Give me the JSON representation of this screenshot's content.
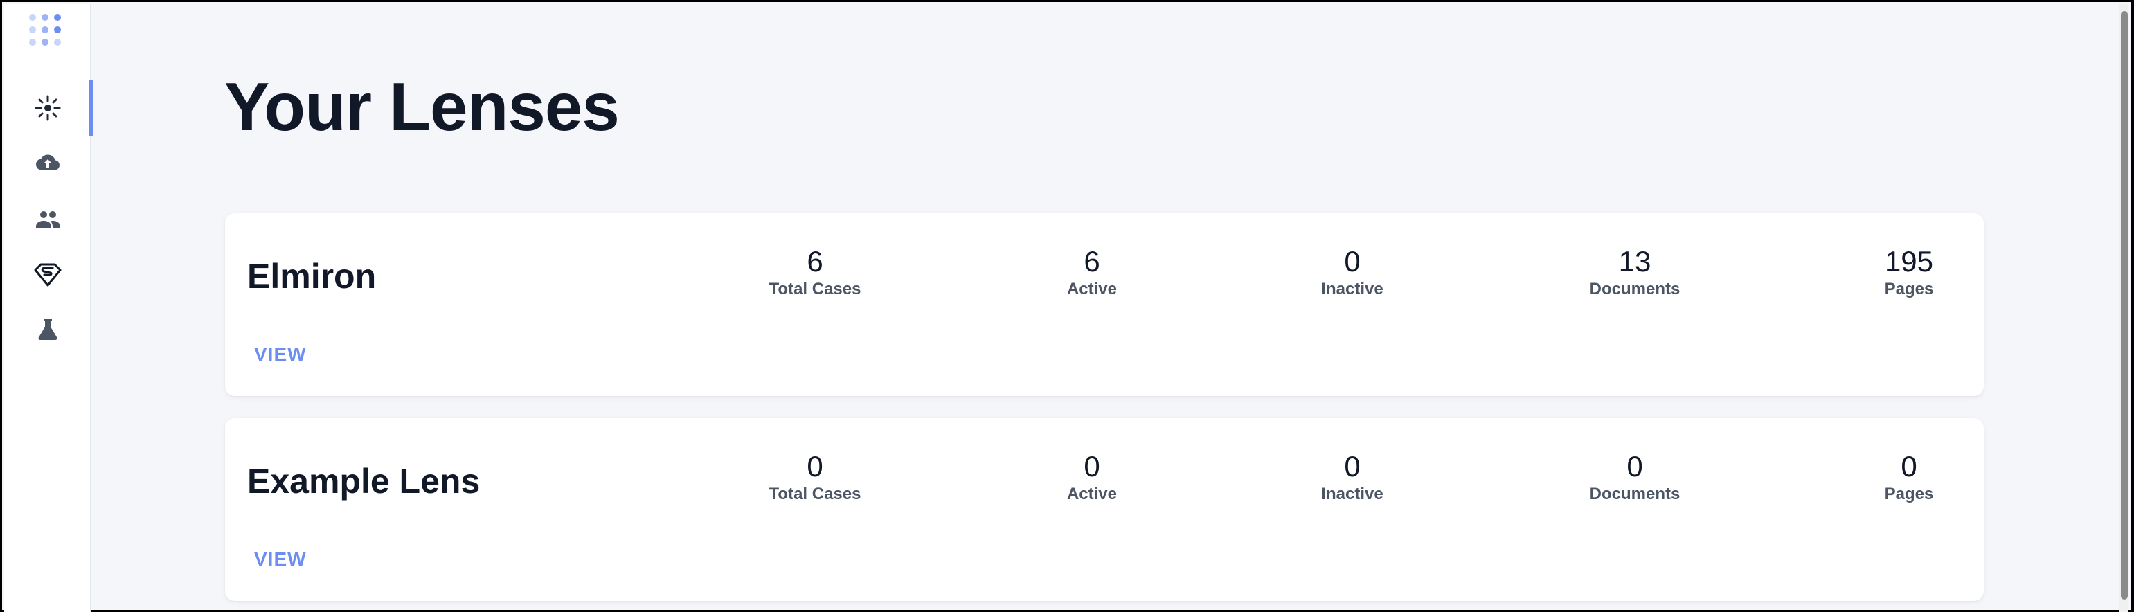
{
  "page": {
    "title": "Your Lenses"
  },
  "colors": {
    "accent": "#6b8ef0",
    "text": "#111827",
    "muted": "#4b5563",
    "background": "#f5f6fa"
  },
  "sidebar": {
    "logo": "dots-grid-logo",
    "items": [
      {
        "icon": "lens-sparkle-icon",
        "active": true
      },
      {
        "icon": "cloud-upload-icon",
        "active": false
      },
      {
        "icon": "people-icon",
        "active": false
      },
      {
        "icon": "superman-shield-icon",
        "active": false
      },
      {
        "icon": "flask-icon",
        "active": false
      }
    ]
  },
  "lenses": [
    {
      "name": "Elmiron",
      "view_label": "VIEW",
      "stats": [
        {
          "value": "6",
          "label": "Total Cases"
        },
        {
          "value": "6",
          "label": "Active"
        },
        {
          "value": "0",
          "label": "Inactive"
        },
        {
          "value": "13",
          "label": "Documents"
        },
        {
          "value": "195",
          "label": "Pages"
        }
      ]
    },
    {
      "name": "Example Lens",
      "view_label": "VIEW",
      "stats": [
        {
          "value": "0",
          "label": "Total Cases"
        },
        {
          "value": "0",
          "label": "Active"
        },
        {
          "value": "0",
          "label": "Inactive"
        },
        {
          "value": "0",
          "label": "Documents"
        },
        {
          "value": "0",
          "label": "Pages"
        }
      ]
    }
  ]
}
